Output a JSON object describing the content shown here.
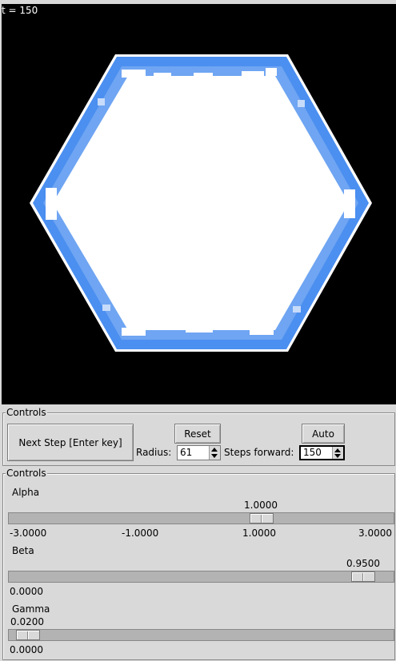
{
  "simulation": {
    "time_label": "t = 150"
  },
  "controls_top": {
    "title": "Controls",
    "next_step_label": "Next Step [Enter key]",
    "reset_label": "Reset",
    "auto_label": "Auto",
    "radius_label": "Radius:",
    "radius_value": "61",
    "steps_label": "Steps forward:",
    "steps_value": "150"
  },
  "controls_params": {
    "title": "Controls",
    "alpha": {
      "name": "Alpha",
      "value": "1.0000",
      "value_num": 1.0,
      "min": -3.0,
      "max": 3.0,
      "ticks": [
        "-3.0000",
        "-1.0000",
        "1.0000",
        "3.0000"
      ]
    },
    "beta": {
      "name": "Beta",
      "value": "0.9500",
      "value_num": 0.95,
      "min": 0.0,
      "max": 1.0,
      "ticks": [
        "0.0000"
      ]
    },
    "gamma": {
      "name": "Gamma",
      "value": "0.0200",
      "value_num": 0.02,
      "min": 0.0,
      "max": 1.0,
      "ticks": [
        "0.0000"
      ]
    }
  },
  "colors": {
    "crystal_edge": "#4b8ff0",
    "crystal_light": "#9fc3f7",
    "crystal_core": "#ffffff",
    "background": "#000000"
  }
}
